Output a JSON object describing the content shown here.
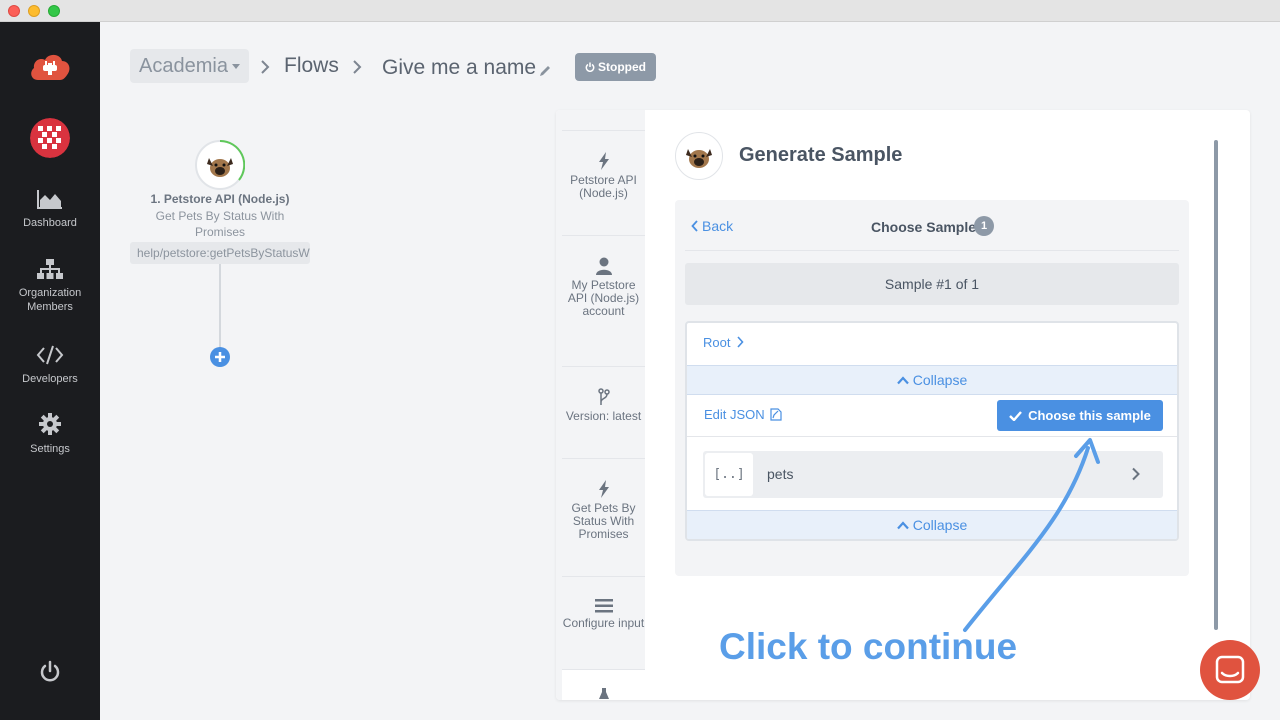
{
  "window": {
    "title": ""
  },
  "nav": {
    "items": [
      {
        "label": "Dashboard",
        "icon": "chart-area-icon"
      },
      {
        "label": "Organization Members",
        "icon": "sitemap-icon"
      },
      {
        "label": "Developers",
        "icon": "code-icon"
      },
      {
        "label": "Settings",
        "icon": "gear-icon"
      }
    ]
  },
  "breadcrumb": {
    "org": "Academia",
    "flows": "Flows",
    "flow_name": "Give me a name",
    "status": "Stopped"
  },
  "flow": {
    "step_title": "1. Petstore API (Node.js)",
    "step_desc": "Get Pets By Status With Promises",
    "step_path": "help/petstore:getPetsByStatusWithPromises"
  },
  "panel": {
    "tabs": [
      {
        "label": "Petstore API (Node.js)",
        "icon": "bolt-icon"
      },
      {
        "label": "My Petstore API (Node.js) account",
        "icon": "user-icon"
      },
      {
        "label": "Version: latest",
        "icon": "branch-icon"
      },
      {
        "label": "Get Pets By Status With Promises",
        "icon": "bolt-icon"
      },
      {
        "label": "Configure input",
        "icon": "menu-icon"
      }
    ],
    "title": "Generate Sample",
    "back": "Back",
    "choose_title": "Choose Sample",
    "badge": "1",
    "sample_count": "Sample #1 of 1",
    "root": "Root",
    "collapse": "Collapse",
    "edit_json": "Edit JSON",
    "choose_button": "Choose this sample",
    "array_glyph": "[..]",
    "pets_label": "pets"
  },
  "annotation": "Click to continue",
  "colors": {
    "accent": "#4a90e2",
    "nav_bg": "#1b1c1f",
    "brand": "#e0533f"
  }
}
